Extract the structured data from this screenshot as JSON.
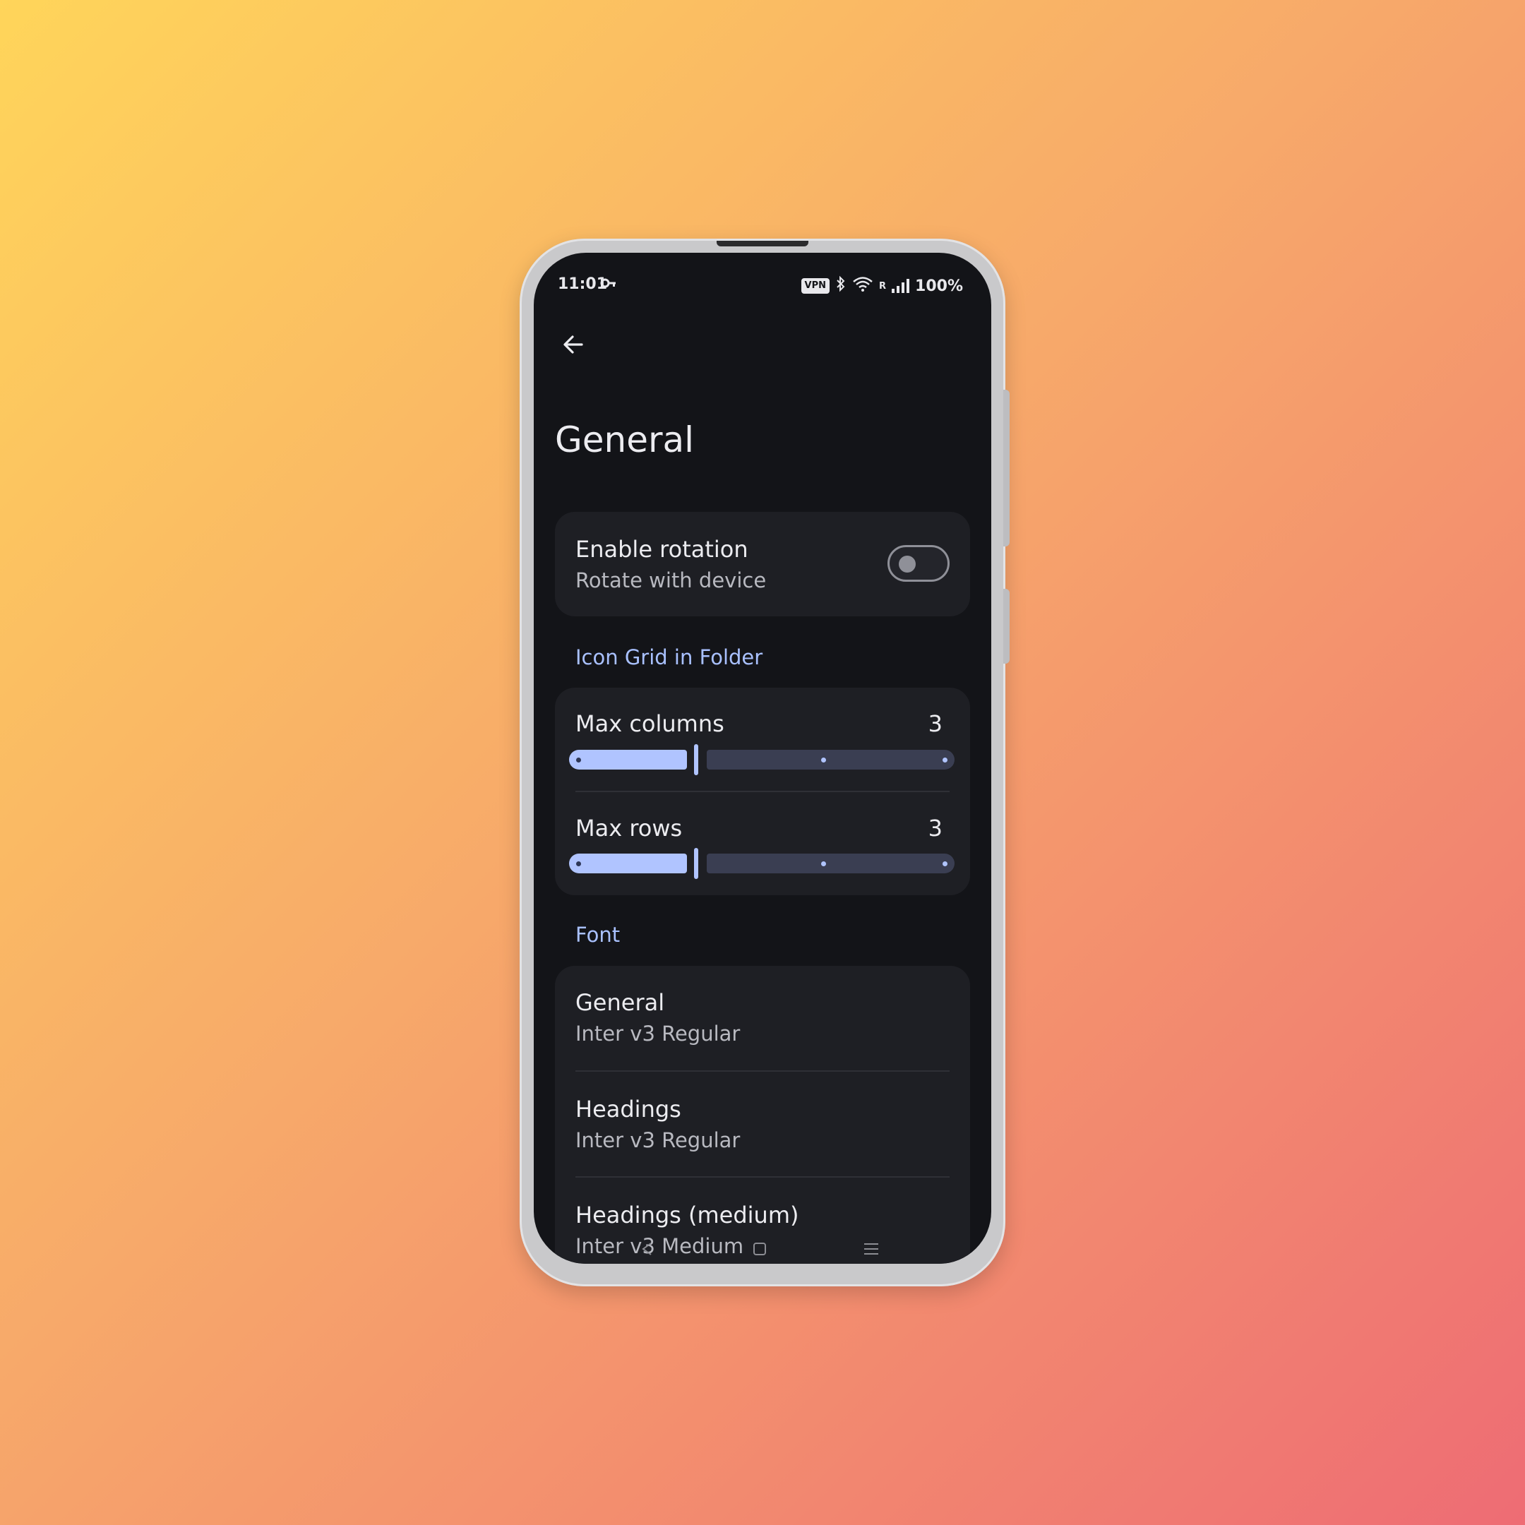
{
  "status_bar": {
    "time": "11:01",
    "key_icon": "key-icon",
    "vpn_label": "VPN",
    "roaming": "R",
    "battery": "100%"
  },
  "header": {
    "title": "General"
  },
  "rotation": {
    "title": "Enable rotation",
    "subtitle": "Rotate with device",
    "enabled": false
  },
  "icon_grid": {
    "section_label": "Icon Grid in Folder",
    "max_columns": {
      "label": "Max columns",
      "value": "3"
    },
    "max_rows": {
      "label": "Max rows",
      "value": "3"
    }
  },
  "font": {
    "section_label": "Font",
    "items": [
      {
        "title": "General",
        "value": "Inter v3 Regular"
      },
      {
        "title": "Headings",
        "value": "Inter v3 Regular"
      },
      {
        "title": "Headings (medium)",
        "value": "Inter v3 Medium"
      }
    ]
  },
  "colors": {
    "accent": "#b0c4ff",
    "section_label": "#a9c1ff",
    "background": "#131418",
    "card": "#1e1f24"
  }
}
